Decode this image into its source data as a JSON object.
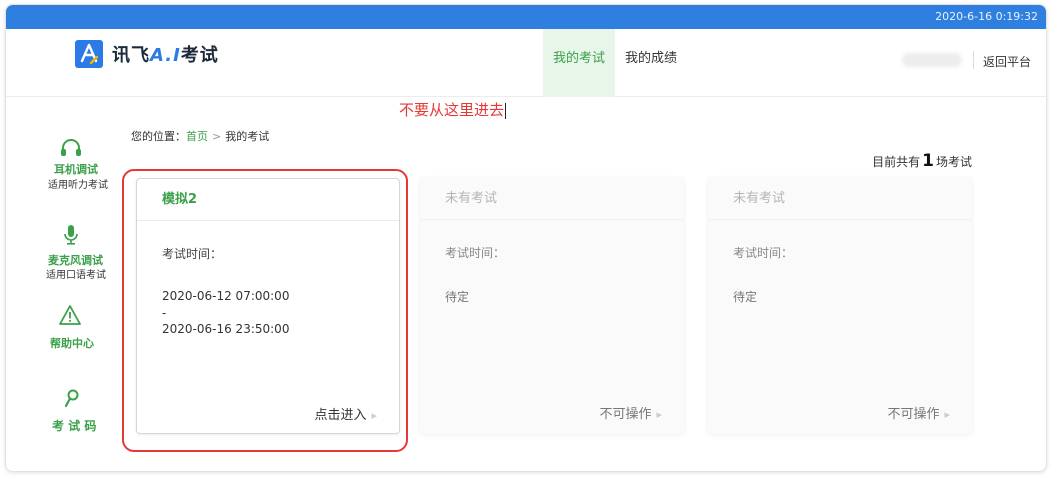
{
  "topbar": {
    "datetime": "2020-6-16 0:19:32"
  },
  "header": {
    "logo_prefix": "讯飞",
    "logo_ai": "A.I",
    "logo_suffix": "考试",
    "nav": [
      {
        "label": "我的考试",
        "active": true
      },
      {
        "label": "我的成绩",
        "active": false
      }
    ],
    "back_label": "返回平台"
  },
  "annotation": "不要从这里进去",
  "breadcrumb": {
    "prefix": "您的位置：",
    "home": "首页",
    "separator": ">",
    "current": "我的考试"
  },
  "sidebar": [
    {
      "icon": "headphones-icon",
      "title": "耳机调试",
      "sub": "适用听力考试"
    },
    {
      "icon": "microphone-icon",
      "title": "麦克风调试",
      "sub": "适用口语考试"
    },
    {
      "icon": "warning-triangle-icon",
      "title": "帮助中心",
      "sub": ""
    },
    {
      "icon": "key-icon",
      "title": "考 试 码",
      "sub": ""
    }
  ],
  "summary": {
    "prefix": "目前共有",
    "count": "1",
    "suffix": "场考试"
  },
  "cards": [
    {
      "title": "模拟2",
      "time_label": "考试时间：",
      "start": "2020-06-12 07:00:00",
      "dash": "-",
      "end": "2020-06-16 23:50:00",
      "action": "点击进入",
      "available": true
    },
    {
      "title": "未有考试",
      "time_label": "考试时间：",
      "status": "待定",
      "action": "不可操作",
      "available": false
    },
    {
      "title": "未有考试",
      "time_label": "考试时间：",
      "status": "待定",
      "action": "不可操作",
      "available": false
    }
  ],
  "colors": {
    "accent_blue": "#2f7fe0",
    "accent_green": "#3aa14a",
    "highlight_red": "#e53935"
  }
}
